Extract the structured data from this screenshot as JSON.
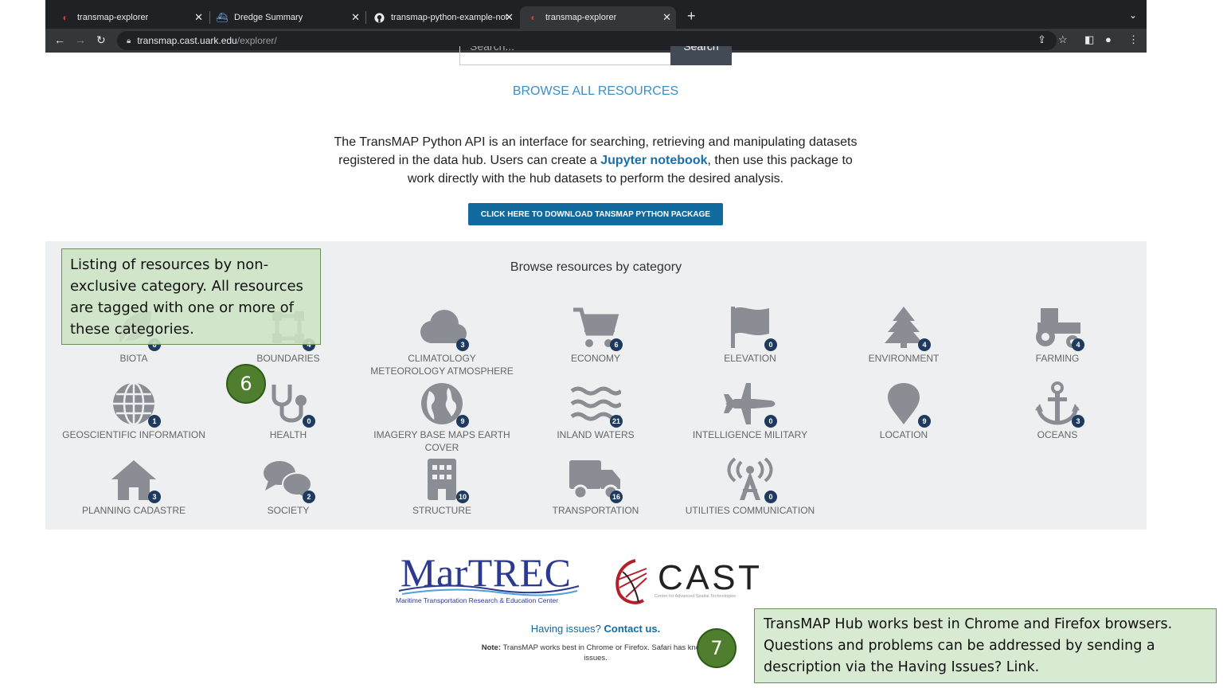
{
  "browser": {
    "tabs": [
      {
        "label": "transmap-explorer",
        "icon": "transmap-icon"
      },
      {
        "label": "Dredge Summary",
        "icon": "ship-icon"
      },
      {
        "label": "transmap-python-example-not",
        "icon": "github-icon"
      },
      {
        "label": "transmap-explorer",
        "icon": "transmap-icon",
        "active": true
      }
    ],
    "url_host": "transmap.cast.uark.edu",
    "url_path": "/explorer/"
  },
  "search": {
    "placeholder": "Search...",
    "button": "Search"
  },
  "browse_all": "BROWSE ALL RESOURCES",
  "intro": {
    "part1": "The TransMAP Python API is an interface for searching, retrieving and manipulating datasets registered in the data hub. Users can create a ",
    "link": "Jupyter notebook",
    "part2": ", then use this package to work directly with the hub datasets to perform the desired analysis."
  },
  "download_button": "CLICK HERE TO DOWNLOAD TANSMAP PYTHON PACKAGE",
  "categories_title": "Browse resources by category",
  "categories": [
    {
      "label": "BIOTA",
      "count": "6",
      "icon": "leaf-icon"
    },
    {
      "label": "BOUNDARIES",
      "count": "4",
      "icon": "boundary-icon"
    },
    {
      "label": "CLIMATOLOGY METEOROLOGY ATMOSPHERE",
      "count": "3",
      "icon": "cloud-icon"
    },
    {
      "label": "ECONOMY",
      "count": "6",
      "icon": "cart-icon"
    },
    {
      "label": "ELEVATION",
      "count": "0",
      "icon": "flag-icon"
    },
    {
      "label": "ENVIRONMENT",
      "count": "4",
      "icon": "tree-icon"
    },
    {
      "label": "FARMING",
      "count": "4",
      "icon": "tractor-icon"
    },
    {
      "label": "GEOSCIENTIFIC INFORMATION",
      "count": "1",
      "icon": "globe-icon"
    },
    {
      "label": "HEALTH",
      "count": "0",
      "icon": "stethoscope-icon"
    },
    {
      "label": "IMAGERY BASE MAPS EARTH COVER",
      "count": "9",
      "icon": "earth-icon"
    },
    {
      "label": "INLAND WATERS",
      "count": "21",
      "icon": "water-icon"
    },
    {
      "label": "INTELLIGENCE MILITARY",
      "count": "0",
      "icon": "jet-icon"
    },
    {
      "label": "LOCATION",
      "count": "9",
      "icon": "map-pin-icon"
    },
    {
      "label": "OCEANS",
      "count": "3",
      "icon": "anchor-icon"
    },
    {
      "label": "PLANNING CADASTRE",
      "count": "3",
      "icon": "house-icon"
    },
    {
      "label": "SOCIETY",
      "count": "2",
      "icon": "comments-icon"
    },
    {
      "label": "STRUCTURE",
      "count": "10",
      "icon": "building-icon"
    },
    {
      "label": "TRANSPORTATION",
      "count": "16",
      "icon": "truck-icon"
    },
    {
      "label": "UTILITIES COMMUNICATION",
      "count": "0",
      "icon": "tower-icon"
    }
  ],
  "callouts": {
    "categories": "Listing of resources by non-exclusive category. All resources are tagged with one or more of these categories.",
    "support": "TransMAP Hub works best in Chrome and Firefox browsers. Questions and problems can be addressed by sending a description via the Having Issues? Link."
  },
  "steps": {
    "six": "6",
    "seven": "7"
  },
  "logos": {
    "martrec": "MarTREC",
    "martrec_sub": "Maritime Transportation Research & Education Center",
    "cast": "CAST",
    "cast_sub": "Center for Advanced Spatial Technologies"
  },
  "issues": {
    "question": "Having issues? ",
    "link": "Contact us."
  },
  "note": {
    "label": "Note:",
    "text": " TransMAP works best in Chrome or Firefox. Safari has known issues."
  },
  "colors": {
    "accent": "#126a9e",
    "badge": "#1e3a5f",
    "icon_gray": "#8a8e94",
    "callout_bg": "#d9ead3",
    "step_bg": "#4f7f2e"
  }
}
